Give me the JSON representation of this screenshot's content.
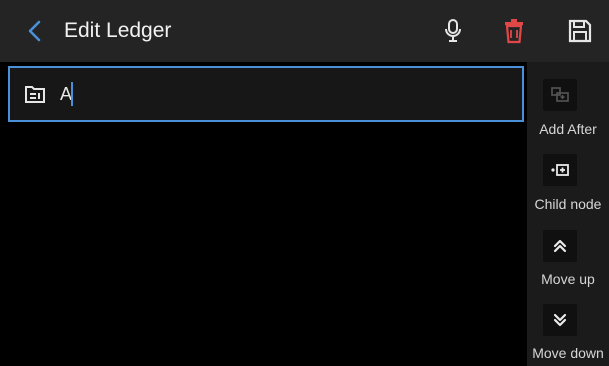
{
  "header": {
    "title": "Edit Ledger"
  },
  "editor": {
    "value": "A"
  },
  "side_actions": [
    {
      "label": "Add After"
    },
    {
      "label": "Child node"
    },
    {
      "label": "Move up"
    },
    {
      "label": "Move down"
    }
  ],
  "colors": {
    "accent": "#4a90d9",
    "header_bg": "#242424",
    "delete_icon": "#e04848",
    "side_bg": "#1b1b1b"
  }
}
